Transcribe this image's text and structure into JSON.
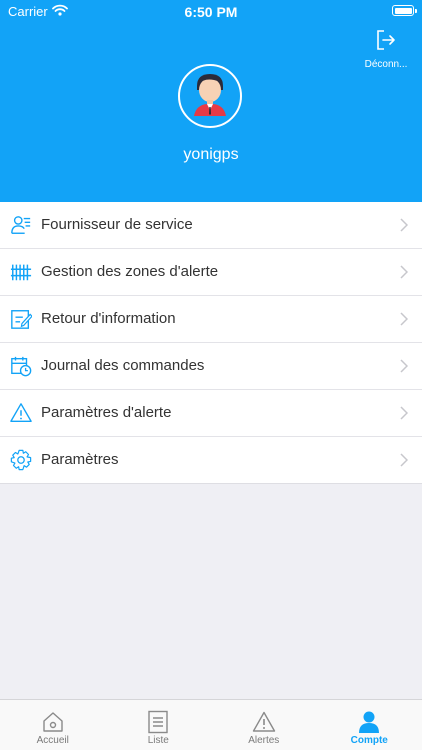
{
  "status_bar": {
    "carrier": "Carrier",
    "time": "6:50 PM"
  },
  "header": {
    "logout_label": "Déconn...",
    "username": "yonigps"
  },
  "menu": {
    "items": [
      {
        "label": "Fournisseur de service",
        "icon": "service-provider-icon"
      },
      {
        "label": "Gestion des zones d'alerte",
        "icon": "fence-icon"
      },
      {
        "label": "Retour d'information",
        "icon": "feedback-icon"
      },
      {
        "label": "Journal des commandes",
        "icon": "calendar-clock-icon"
      },
      {
        "label": "Paramètres d'alerte",
        "icon": "warning-icon"
      },
      {
        "label": "Paramètres",
        "icon": "gear-icon"
      }
    ]
  },
  "tabbar": {
    "tabs": [
      {
        "label": "Accueil",
        "icon": "home-icon"
      },
      {
        "label": "Liste",
        "icon": "list-icon"
      },
      {
        "label": "Alertes",
        "icon": "warning-icon"
      },
      {
        "label": "Compte",
        "icon": "person-icon",
        "active": true
      }
    ]
  },
  "colors": {
    "accent": "#12a3f7",
    "background": "#efeff4"
  }
}
